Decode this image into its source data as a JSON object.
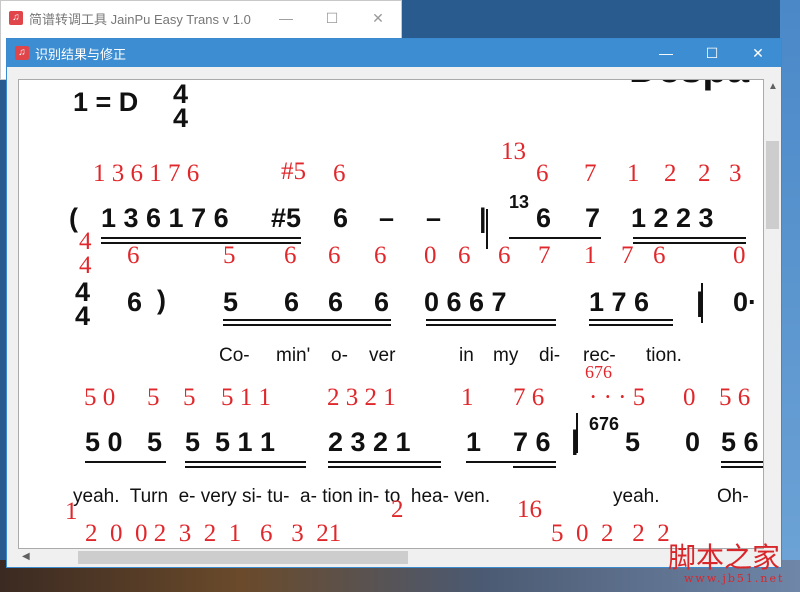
{
  "back_window": {
    "title": "简谱转调工具 JainPu Easy Trans v 1.0"
  },
  "front_window": {
    "title": "识别结果与修正"
  },
  "window_controls": {
    "minimize": "—",
    "maximize": "☐",
    "close": "✕"
  },
  "score": {
    "song_title": "Despa",
    "key": "1 = D",
    "time_sig_top": "4",
    "time_sig_bottom": "4",
    "row1_red": [
      "1 3 6 1 7 6",
      "#5",
      "6",
      "13",
      "6",
      "7",
      "1",
      "2",
      "2",
      "3"
    ],
    "row1_notes": [
      "(",
      "1 3 6 1 7 6",
      "#5",
      "6",
      "–",
      "–",
      "|",
      "13",
      "6",
      "7",
      "1 2 2 3"
    ],
    "side_red": [
      "4",
      "4"
    ],
    "row2_red": [
      "6",
      "5",
      "6",
      "6",
      "6",
      "0",
      "6",
      "6",
      "7",
      "1",
      "7",
      "6",
      "0"
    ],
    "row2_notes": [
      "4",
      "4",
      "6",
      ")",
      "5",
      "6",
      "6",
      "6",
      "0 6 6 7",
      "1 7 6",
      "|",
      "0·"
    ],
    "lyrics1": [
      "Co-",
      "min'",
      "o-",
      "ver",
      "in",
      "my",
      "di-",
      "rec-",
      "tion."
    ],
    "row3_red": [
      "676",
      "5 0",
      "5",
      "5",
      "5 1 1",
      "2 3 2 1",
      "1",
      "7 6",
      "· · · 5",
      "0",
      "5 6"
    ],
    "row3_notes": [
      "5 0",
      "5",
      "5  5 1 1",
      "2 3 2 1",
      "1",
      "7 6",
      "|",
      "676",
      "5",
      "0",
      "5 6"
    ],
    "lyrics2": [
      "yeah.  Turn  e- very si- tu-  a- tion in- to  hea- ven.",
      "yeah.",
      "Oh-"
    ],
    "row4_red": [
      "1",
      "2",
      "16",
      "2  0  0 2  3  2  1   6   3  21",
      "5  0  2   2  2"
    ]
  },
  "watermark": {
    "text": "脚本之家",
    "url": "www.jb51.net"
  }
}
